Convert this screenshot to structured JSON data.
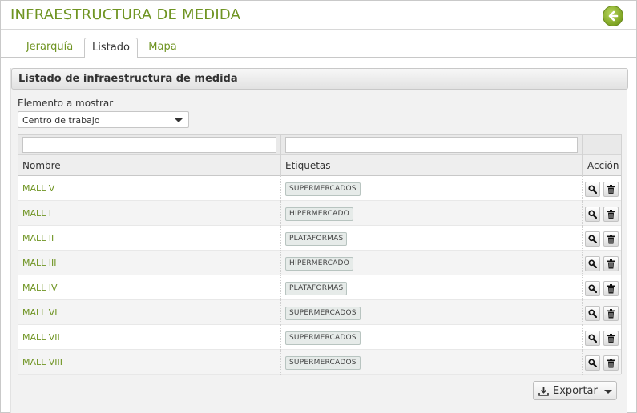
{
  "header": {
    "title": "INFRAESTRUCTURA DE MEDIDA",
    "back_icon": "back-arrow-icon",
    "accent_color": "#6f9422"
  },
  "tabs": [
    {
      "label": "Jerarquía",
      "active": false
    },
    {
      "label": "Listado",
      "active": true
    },
    {
      "label": "Mapa",
      "active": false
    }
  ],
  "panel": {
    "title": "Listado de infraestructura de medida",
    "element_label": "Elemento a mostrar",
    "element_value": "Centro de trabajo"
  },
  "table": {
    "filters": {
      "name": "",
      "tags": ""
    },
    "columns": {
      "name": "Nombre",
      "tags": "Etiquetas",
      "action": "Acción"
    },
    "rows": [
      {
        "name": "MALL V",
        "tag": "SUPERMERCADOS"
      },
      {
        "name": "MALL I",
        "tag": "HIPERMERCADO"
      },
      {
        "name": "MALL II",
        "tag": "PLATAFORMAS"
      },
      {
        "name": "MALL III",
        "tag": "HIPERMERCADO"
      },
      {
        "name": "MALL IV",
        "tag": "PLATAFORMAS"
      },
      {
        "name": "MALL VI",
        "tag": "SUPERMERCADOS"
      },
      {
        "name": "MALL VII",
        "tag": "SUPERMERCADOS"
      },
      {
        "name": "MALL VIII",
        "tag": "SUPERMERCADOS"
      }
    ],
    "row_actions": [
      "search-icon",
      "trash-icon"
    ]
  },
  "export": {
    "label": "Exportar",
    "icon": "download-icon"
  }
}
